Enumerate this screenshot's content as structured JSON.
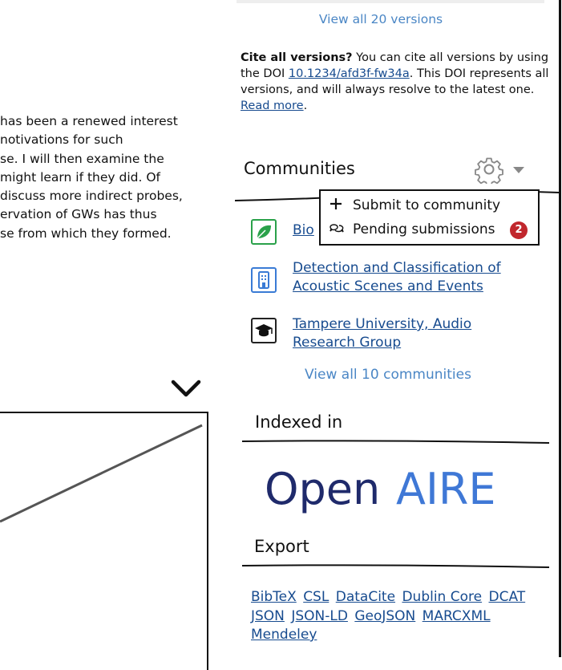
{
  "abstract": {
    "lines": [
      "has been a renewed interest",
      "notivations for such",
      "se. I will then examine the",
      "might learn if they did. Of",
      "discuss more indirect probes,",
      "ervation of GWs has thus",
      "se from which they formed."
    ]
  },
  "versions": {
    "view_all": "View all 20 versions"
  },
  "cite": {
    "lead": "Cite all versions?",
    "text_before_doi": " You can cite all versions by using the DOI ",
    "doi": "10.1234/afd3f-fw34a",
    "text_after_doi": ". This DOI represents all versions, and will always resolve to the latest one. ",
    "read_more": "Read more",
    "period": "."
  },
  "communities": {
    "title": "Communities",
    "gear_icon": "gear-icon",
    "dropdown": {
      "submit": "Submit to community",
      "pending": "Pending submissions",
      "pending_count": "2"
    },
    "items": [
      {
        "label": "Bio",
        "icon": "leaf-icon"
      },
      {
        "label": "Detection and Classification of Acoustic Scenes and Events",
        "line1": "Detection and Classification of",
        "line2": "Acoustic Scenes and Events",
        "icon": "building-icon"
      },
      {
        "label": "Tampere University, Audio Research Group",
        "line1": "Tampere University, Audio",
        "line2": "Research Group",
        "icon": "graduation-cap-icon"
      }
    ],
    "view_all": "View all 10 communities"
  },
  "indexed": {
    "title": "Indexed in",
    "logo_text": {
      "open": "Open",
      "aire": "AIRE"
    }
  },
  "export": {
    "title": "Export",
    "formats": [
      "BibTeX",
      "CSL",
      "DataCite",
      "Dublin Core",
      "DCAT",
      "JSON",
      "JSON-LD",
      "GeoJSON",
      "MARCXML",
      "Mendeley"
    ]
  },
  "colors": {
    "link": "#174b8f",
    "light_link": "#4a86c5",
    "badge": "#c1272d",
    "openaire_dark": "#1f2a6b",
    "openaire_light": "#3f78d6"
  }
}
